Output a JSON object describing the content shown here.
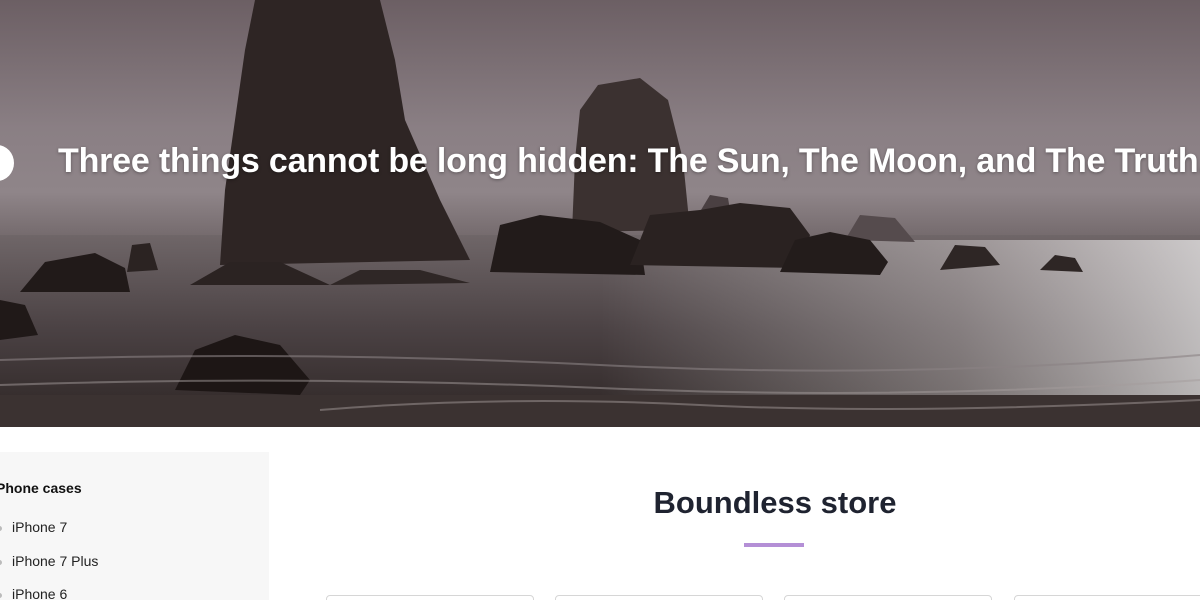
{
  "hero": {
    "quote": "Three things cannot be long hidden: The Sun, The Moon, and The Truth."
  },
  "sidebar": {
    "title": "Phone cases",
    "items": [
      {
        "label": "iPhone 7"
      },
      {
        "label": "iPhone 7 Plus"
      },
      {
        "label": "iPhone 6"
      }
    ]
  },
  "main": {
    "title": "Boundless store",
    "accent_color": "#b48fd6",
    "cards": [
      {},
      {},
      {},
      {}
    ]
  }
}
